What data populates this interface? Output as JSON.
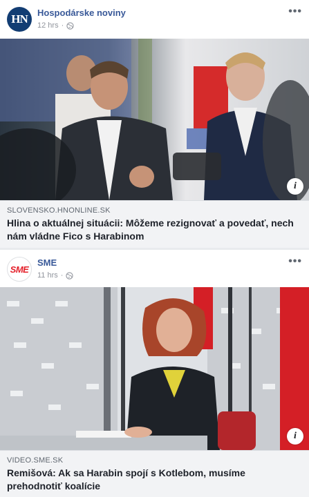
{
  "posts": [
    {
      "page_name": "Hospodárske noviny",
      "avatar_text": "HN",
      "time": "12 hrs",
      "visibility_icon": "globe-icon",
      "more_label": "•••",
      "link_domain": "SLOVENSKO.HNONLINE.SK",
      "headline": "Hlina o aktuálnej situácii: Môžeme rezignovať a povedať, nech nám vládne Fico s Harabinom",
      "info_label": "i"
    },
    {
      "page_name": "SME",
      "avatar_text": "SME",
      "time": "11 hrs",
      "visibility_icon": "globe-icon",
      "more_label": "•••",
      "link_domain": "VIDEO.SME.SK",
      "headline": "Remišová: Ak sa Harabin spojí s Kotlebom, musíme prehodnotiť koalície",
      "info_label": "i"
    }
  ],
  "colors": {
    "page_name": "#385898",
    "hn_brand": "#123d73",
    "sme_brand": "#e4202a",
    "link_bg": "#f2f3f5"
  }
}
